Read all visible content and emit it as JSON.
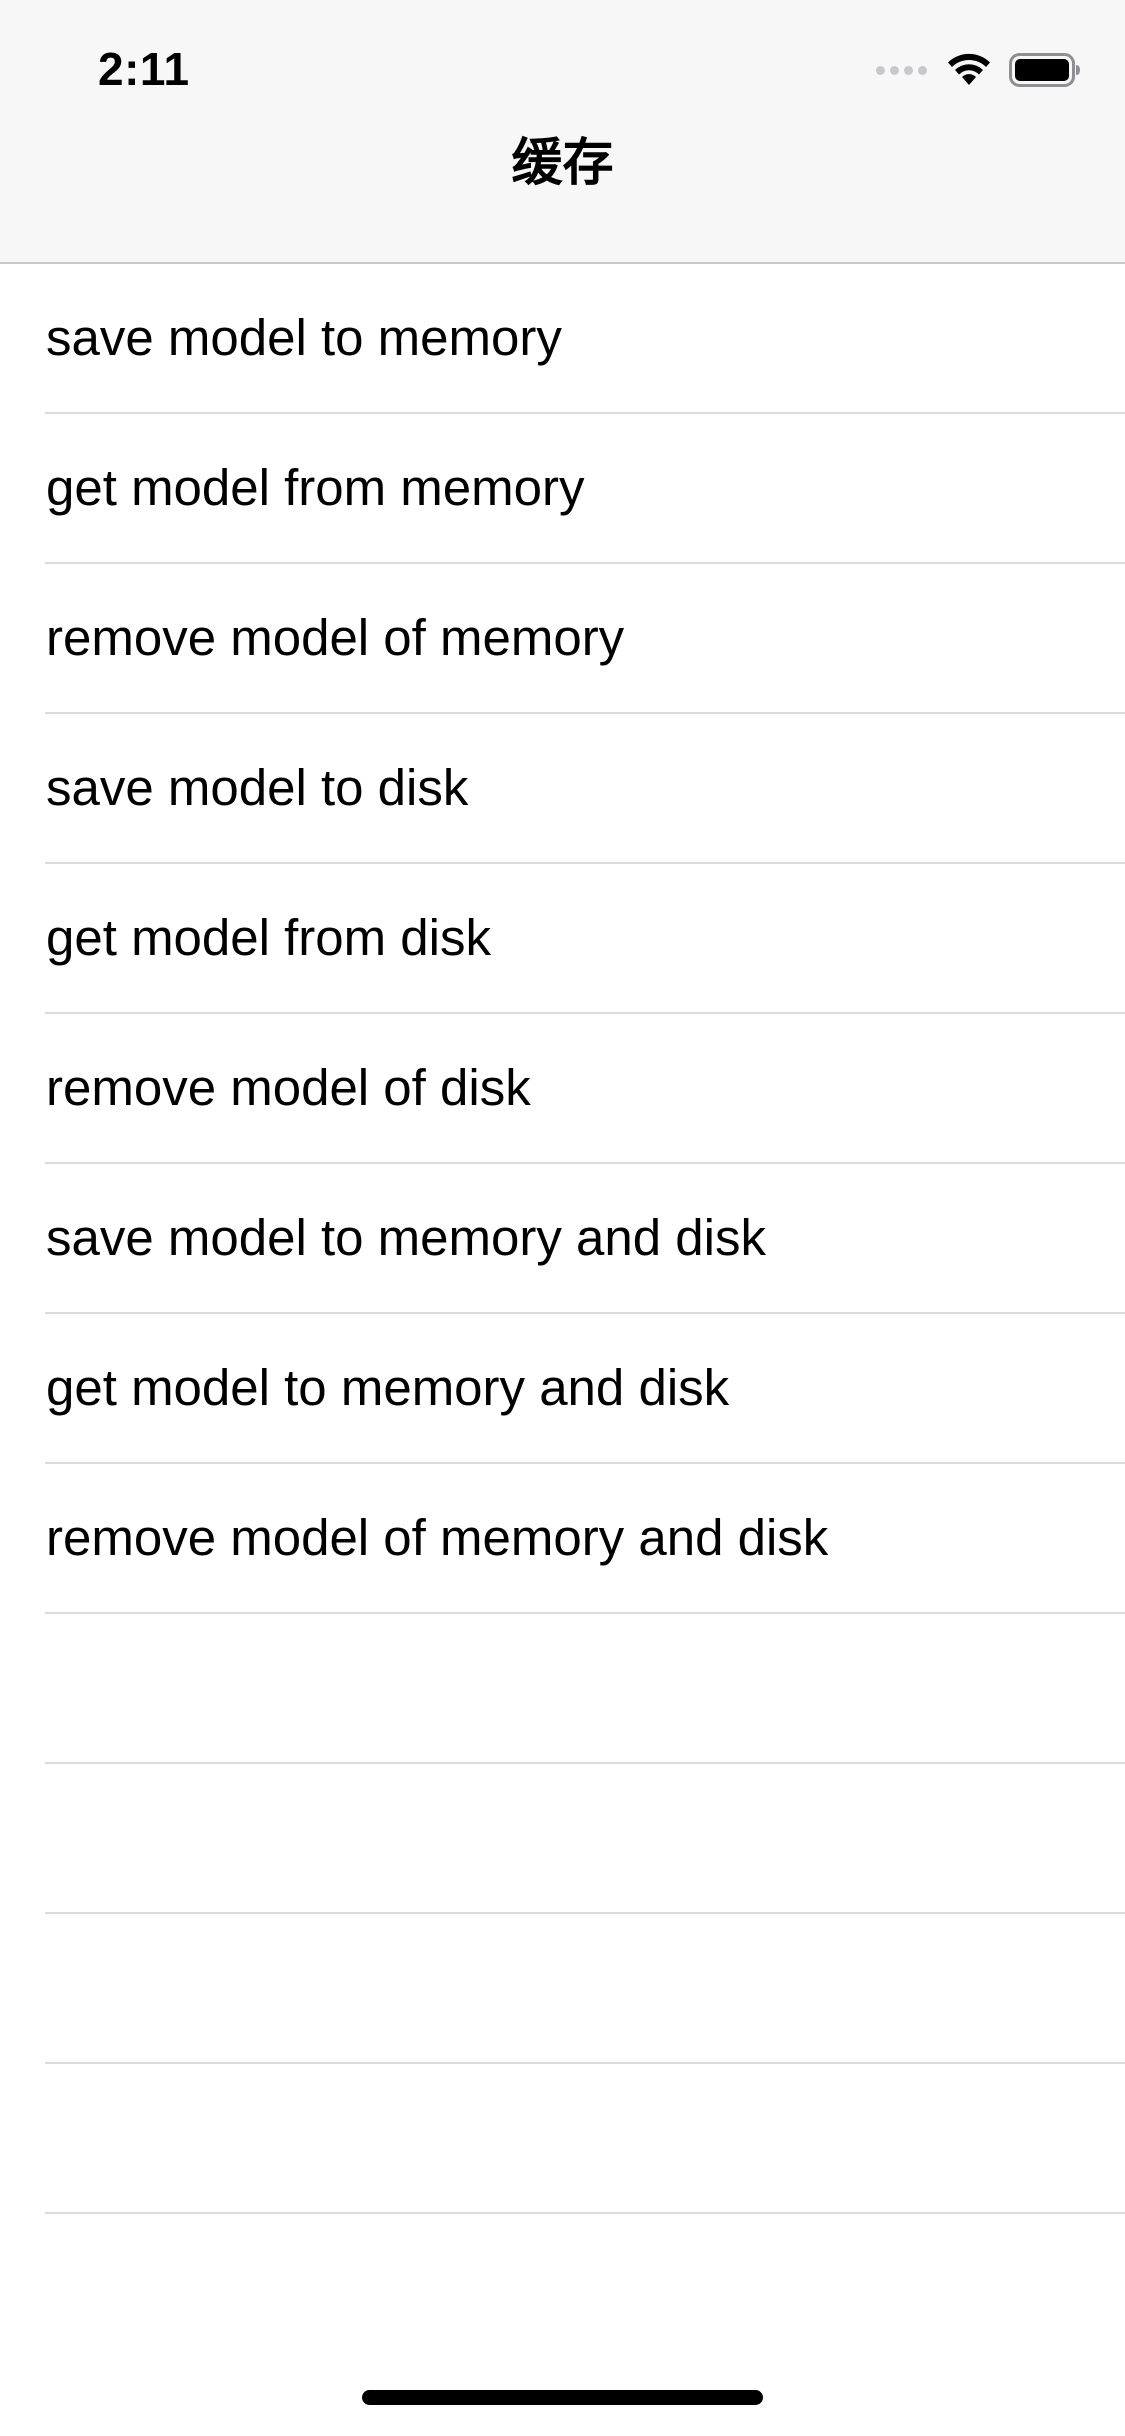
{
  "status_bar": {
    "time": "2:11",
    "icons": [
      "signal-dots-icon",
      "wifi-icon",
      "battery-icon"
    ]
  },
  "nav": {
    "title": "缓存"
  },
  "table": {
    "rows": [
      "save model to memory",
      "get model from memory",
      "remove model of memory",
      "save model to disk",
      "get model from disk",
      "remove model of disk",
      "save model to memory and disk",
      "get model to memory and disk",
      "remove model of memory and disk",
      "",
      "",
      "",
      ""
    ]
  },
  "colors": {
    "bar_background": "#f7f7f7",
    "separator": "#d9d9de",
    "text": "#000000",
    "inactive_signal": "#c7c7cc"
  }
}
